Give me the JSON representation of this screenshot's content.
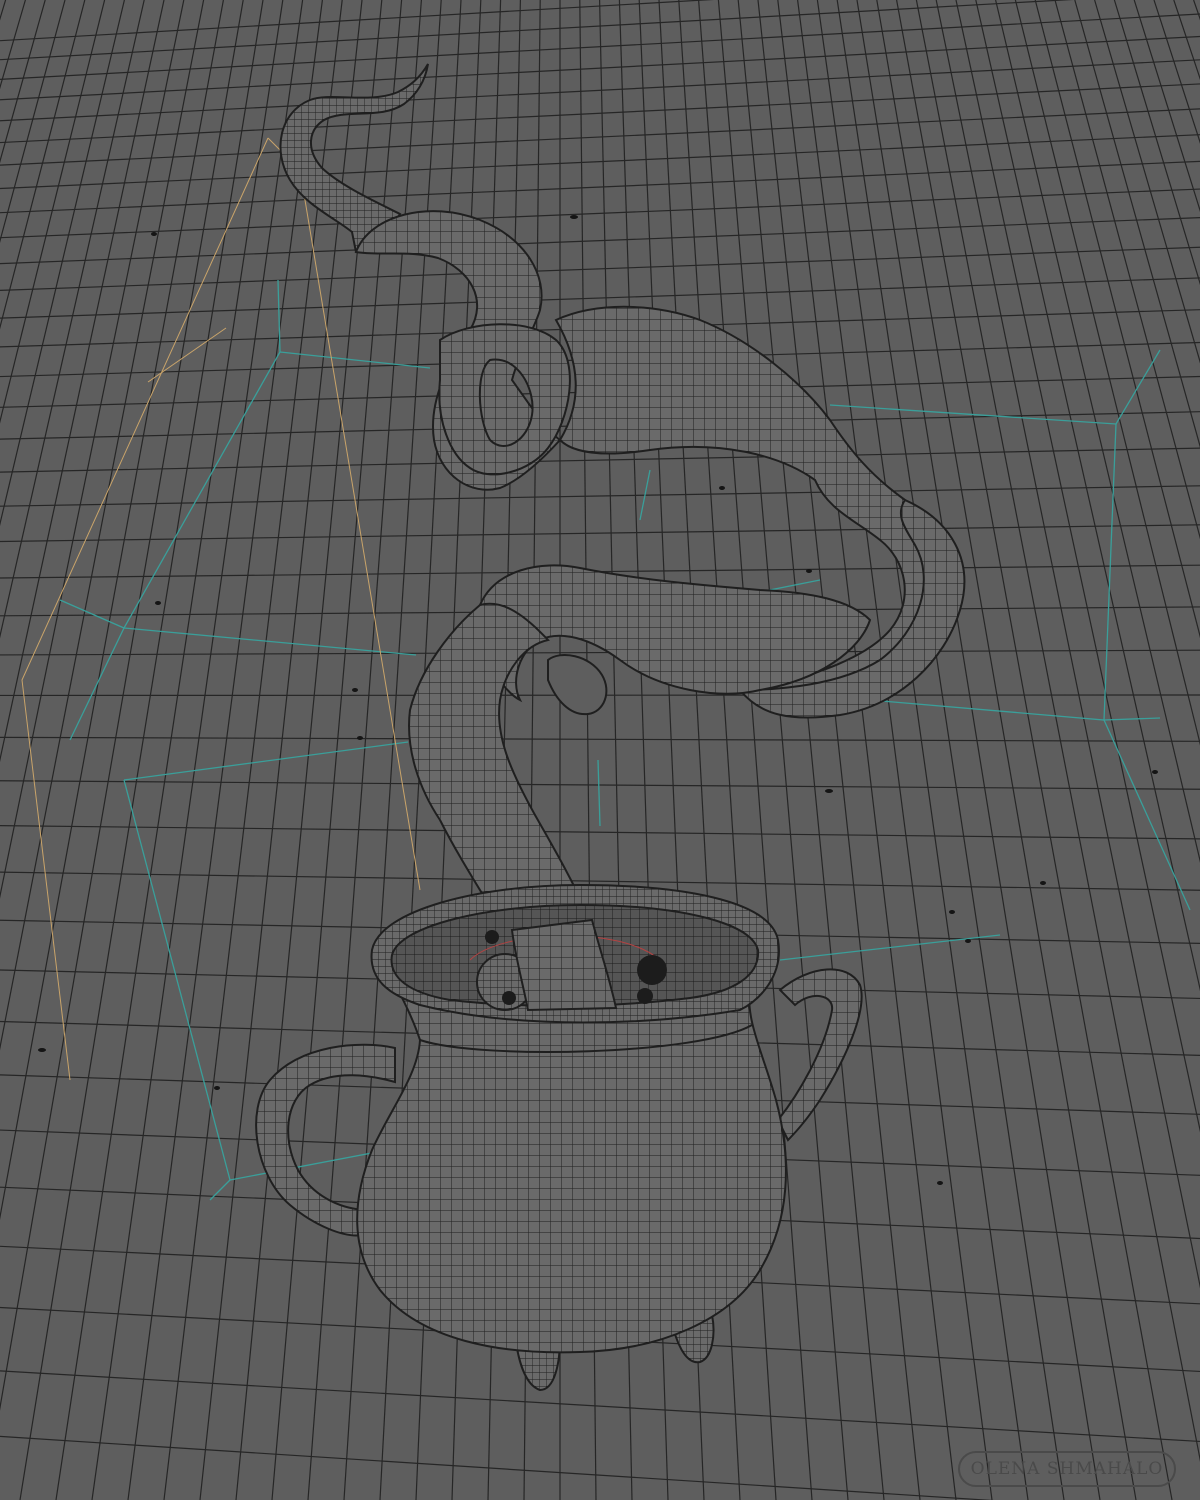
{
  "viewport": {
    "background_color": "#5e5e5e",
    "grid_line_color": "#262626",
    "construction_line_color": "#3a9f9a",
    "camera_frame_color": "#c9a46a",
    "wire_color": "#1f1f1f",
    "model_fill_color": "#6a6a6a"
  },
  "scene": {
    "objects": [
      "cauldron",
      "cauldron-handle-left",
      "cauldron-handle-right",
      "cauldron-feet",
      "smoke-tendril",
      "floating-spheres"
    ]
  },
  "watermark": {
    "text": "OLENA SHMAHALO"
  }
}
